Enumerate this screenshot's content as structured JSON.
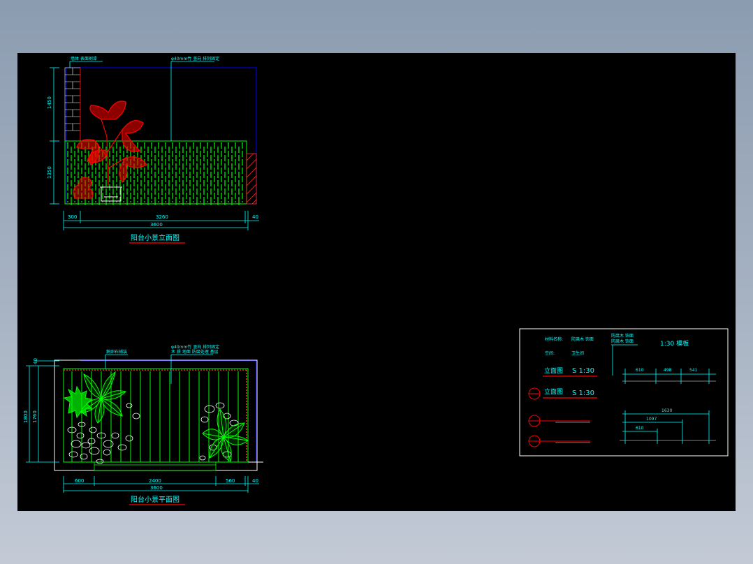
{
  "elevation": {
    "title": "阳台小景立面图",
    "note_left": "墙体 表面刷漆",
    "note_right": "φ40mm竹 竖向 排列固定",
    "dim_height_upper": "1450",
    "dim_height_lower": "1350",
    "dim_bottom": [
      "300",
      "3260",
      "40"
    ],
    "dim_total": "3600"
  },
  "plan": {
    "title": "阳台小景平面图",
    "note_left": "鹅卵石铺装",
    "note_right_1": "φ40mm竹 竖向 排列固定",
    "note_right_2": "木 质 地面 防腐处理 基层",
    "dim_left_top": "40",
    "dim_left_outer": "1800",
    "dim_left_inner": "1760",
    "dim_bottom": [
      "600",
      "2400",
      "560",
      "40"
    ],
    "dim_total": "3600"
  },
  "title_block": {
    "row1_label": "材料名称:",
    "row1_value": "防腐木 饰面",
    "row2_label": "空间:",
    "row2_value": "卫生间",
    "elev_label_1": "立面图",
    "elev_scale_1": "S 1:30",
    "elev_label_2": "立面图",
    "elev_scale_2": "S 1:30",
    "top_note_1": "防腐木 饰面",
    "top_note_2": "防腐木 饰面",
    "scale_title": "1:30  模板",
    "dims_row1": [
      "610",
      "498",
      "541"
    ],
    "dims_row2": [
      "1630",
      "1097",
      "610"
    ]
  },
  "colors": {
    "background": "#000000",
    "bamboo": "#00ff00",
    "plant": "#ff0000",
    "dimension": "#00ffff",
    "frame": "#0000ff",
    "title": "#00ffff"
  }
}
